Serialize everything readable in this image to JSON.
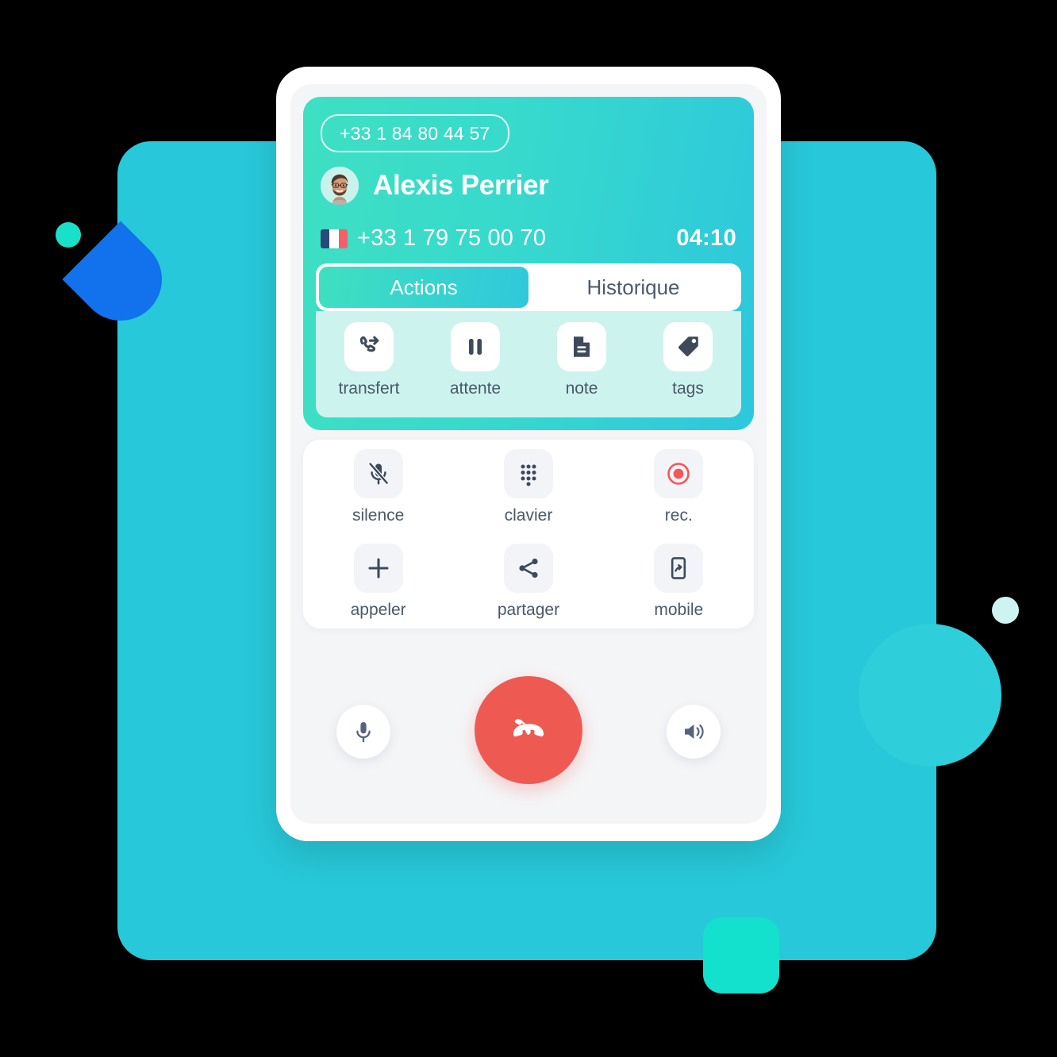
{
  "header": {
    "did_number": "+33 1 84 80 44 57",
    "caller_name": "Alexis Perrier",
    "caller_number": "+33 1 79 75 00 70",
    "call_timer": "04:10",
    "flag_icon": "france-flag-icon",
    "avatar_icon": "avatar"
  },
  "tabs": [
    {
      "label": "Actions",
      "active": true
    },
    {
      "label": "Historique",
      "active": false
    }
  ],
  "actions": [
    {
      "label": "transfert",
      "icon": "call-transfer-icon"
    },
    {
      "label": "attente",
      "icon": "pause-icon"
    },
    {
      "label": "note",
      "icon": "document-icon"
    },
    {
      "label": "tags",
      "icon": "tag-icon"
    }
  ],
  "controls": [
    {
      "label": "silence",
      "icon": "microphone-muted-icon"
    },
    {
      "label": "clavier",
      "icon": "dialpad-icon"
    },
    {
      "label": "rec.",
      "icon": "record-icon"
    },
    {
      "label": "appeler",
      "icon": "plus-icon"
    },
    {
      "label": "partager",
      "icon": "share-icon"
    },
    {
      "label": "mobile",
      "icon": "mobile-transfer-icon"
    }
  ],
  "bottom_bar": {
    "mic_label": "microphone-icon",
    "hangup_label": "hangup-icon",
    "speaker_label": "speaker-icon"
  },
  "colors": {
    "background_rect": "#27C8D9",
    "header_gradient_start": "#3EE0C2",
    "header_gradient_end": "#2DC7DD",
    "actions_strip": "#CDF3EF",
    "hangup_red": "#EE5A52",
    "record_red": "#F4565A",
    "icon_dark": "#3E4A5C",
    "label_text": "#4A5868",
    "accent_blue": "#1271ED",
    "accent_mint": "#14E0CE"
  }
}
